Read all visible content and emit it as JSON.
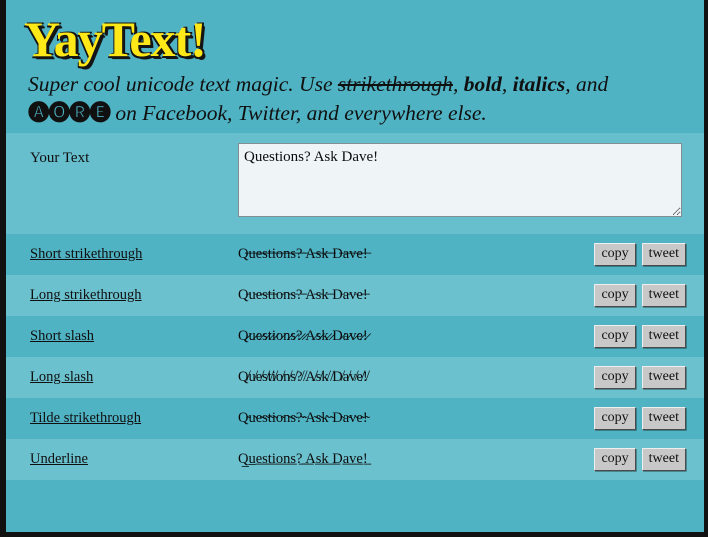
{
  "site": {
    "logo": "YayText!",
    "tagline": {
      "part1": "Super cool unicode text magic. Use ",
      "strike": "strikethrough",
      "part2": ", ",
      "bold": "bold",
      "part3": ", ",
      "italics": "italics",
      "part4": ", and ",
      "circled": "🅐🅞🅡🅔",
      "part5": " on Facebook, Twitter, and everywhere else."
    }
  },
  "form": {
    "label": "Your Text",
    "value": "Questions? Ask Dave!",
    "placeholder": "Your Text"
  },
  "results": {
    "copy_label": "copy",
    "tweet_label": "tweet",
    "rows": [
      {
        "label": "Short strikethrough",
        "output": "Q̶u̶e̶s̶t̶i̶o̶n̶s̶?̶ ̶A̶s̶k̶ ̶D̶a̶v̶e̶!̶",
        "band": "dark"
      },
      {
        "label": "Long strikethrough",
        "output": "Q̵u̵e̵s̵t̵i̵o̵n̵s̵?̵ ̵A̵s̵k̵ ̵D̵a̵v̵e̵!̵",
        "band": "light"
      },
      {
        "label": "Short slash",
        "output": "Q̷u̷e̷s̷t̷i̷o̷n̷s̷?̷ ̷A̷s̷k̷ ̷D̷a̷v̷e̷!̷",
        "band": "dark"
      },
      {
        "label": "Long slash",
        "output": "Q̸u̸e̸s̸t̸i̸o̸n̸s̸?̸ ̸A̸s̸k̸ ̸D̸a̸v̸e̸!̸",
        "band": "light"
      },
      {
        "label": "Tilde strikethrough",
        "output": "Q̴u̴e̴s̴t̴i̴o̴n̴s̴?̴ ̴A̴s̴k̴ ̴D̴a̴v̴e̴!̴",
        "band": "dark"
      },
      {
        "label": "Underline",
        "output": "Q̲u̲e̲s̲t̲i̲o̲n̲s̲?̲ ̲A̲s̲k̲ ̲D̲a̲v̲e̲!̲",
        "band": "light"
      }
    ]
  },
  "colors": {
    "page_bg": "#4fb3c4",
    "row_light": "#6cc1ce",
    "input_band": "#67bfcd",
    "logo_yellow": "#ffe817",
    "textarea_bg": "#eff5f7",
    "button_bg": "#c8c8c8",
    "frame": "#111111"
  }
}
